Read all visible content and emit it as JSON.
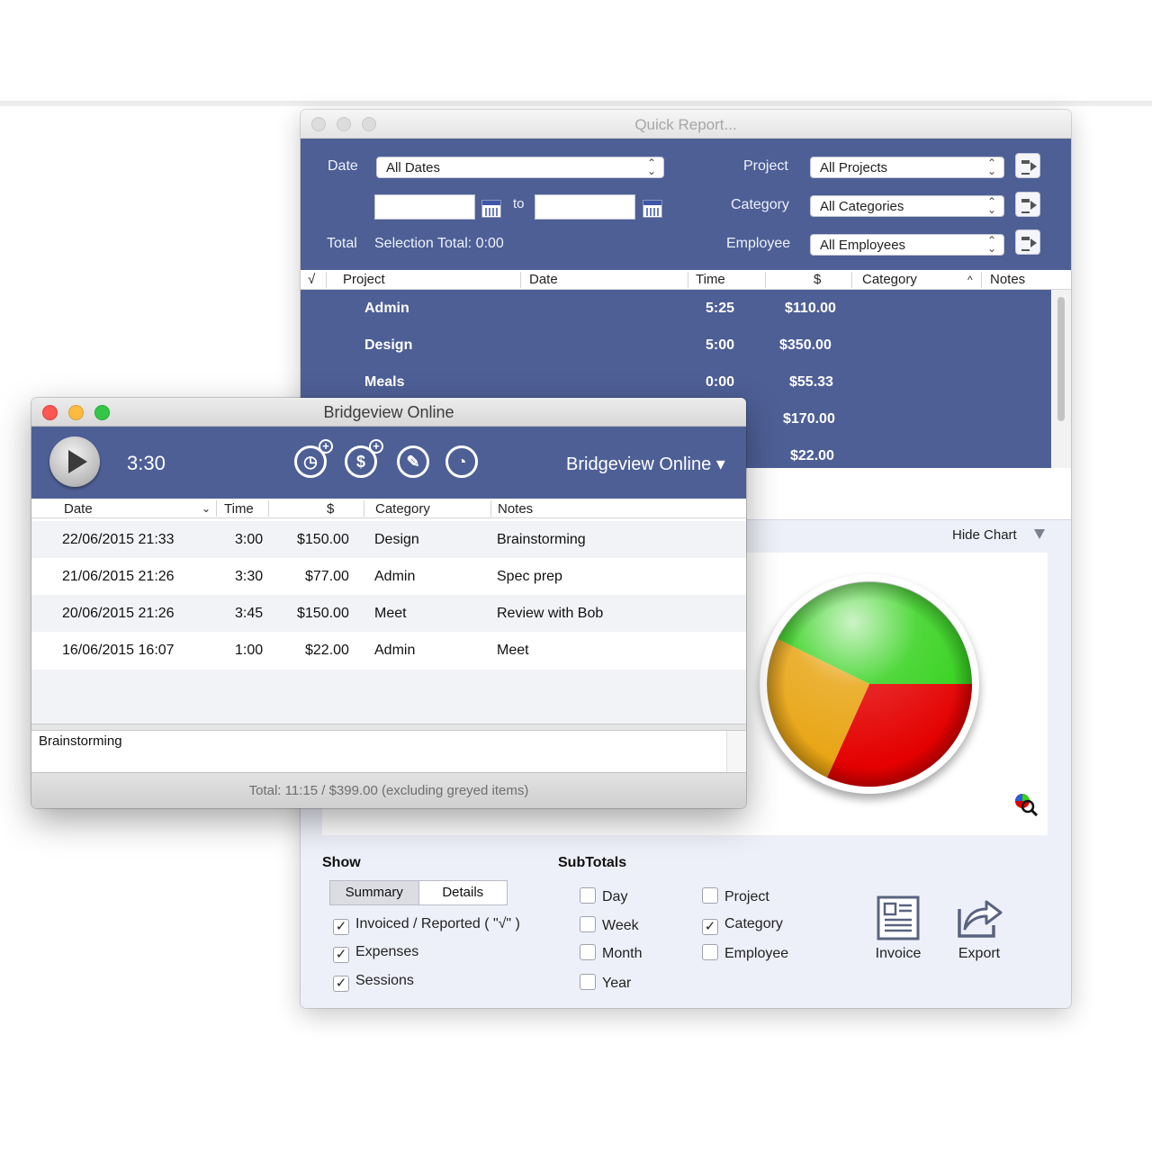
{
  "quick_report": {
    "title": "Quick Report...",
    "filters": {
      "date_label": "Date",
      "date_value": "All Dates",
      "to_label": "to",
      "total_label": "Total",
      "selection_total": "Selection Total: 0:00",
      "project_label": "Project",
      "project_value": "All Projects",
      "category_label": "Category",
      "category_value": "All Categories",
      "employee_label": "Employee",
      "employee_value": "All Employees"
    },
    "columns": {
      "check": "√",
      "project": "Project",
      "date": "Date",
      "time": "Time",
      "amount": "$",
      "category": "Category",
      "notes": "Notes"
    },
    "rows": [
      {
        "project": "Admin",
        "time": "5:25",
        "amount": "$110.00"
      },
      {
        "project": "Design",
        "time": "5:00",
        "amount": "$350.00"
      },
      {
        "project": "Meals",
        "time": "0:00",
        "amount": "$55.33"
      },
      {
        "project": "",
        "time": "",
        "amount": "$170.00"
      },
      {
        "project": "",
        "time": "",
        "amount": "$22.00"
      }
    ],
    "hide_chart": "Hide Chart",
    "show": {
      "label": "Show",
      "summary": "Summary",
      "details": "Details",
      "invoiced": "Invoiced / Reported ( \"√\" )",
      "expenses": "Expenses",
      "sessions": "Sessions"
    },
    "subtotals": {
      "label": "SubTotals",
      "day": "Day",
      "week": "Week",
      "month": "Month",
      "year": "Year",
      "project": "Project",
      "category": "Category",
      "employee": "Employee"
    },
    "invoice_label": "Invoice",
    "export_label": "Export",
    "chart_colors": {
      "green": "#33d11b",
      "red": "#e40000",
      "orange": "#e8a412"
    },
    "check_mark": "✓"
  },
  "bridgeview": {
    "title": "Bridgeview Online",
    "timer": "3:30",
    "project_menu": "Bridgeview Online ▾",
    "columns": {
      "date": "Date",
      "time": "Time",
      "amount": "$",
      "category": "Category",
      "notes": "Notes"
    },
    "rows": [
      {
        "date": "22/06/2015  21:33",
        "time": "3:00",
        "amount": "$150.00",
        "category": "Design",
        "notes": "Brainstorming"
      },
      {
        "date": "21/06/2015  21:26",
        "time": "3:30",
        "amount": "$77.00",
        "category": "Admin",
        "notes": "Spec prep"
      },
      {
        "date": "20/06/2015  21:26",
        "time": "3:45",
        "amount": "$150.00",
        "category": "Meet",
        "notes": "Review with Bob"
      },
      {
        "date": "16/06/2015  16:07",
        "time": "1:00",
        "amount": "$22.00",
        "category": "Admin",
        "notes": "Meet"
      }
    ],
    "notes_text": "Brainstorming",
    "footer": "Total: 11:15 / $399.00 (excluding greyed items)"
  }
}
